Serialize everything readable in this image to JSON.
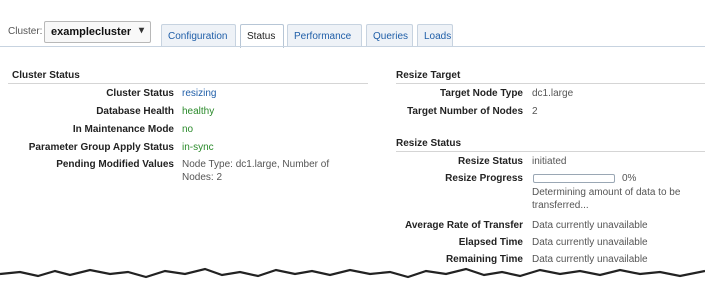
{
  "cluster": {
    "label": "Cluster:",
    "selected": "examplecluster"
  },
  "tabs": [
    {
      "label": "Configuration",
      "active": false
    },
    {
      "label": "Status",
      "active": true
    },
    {
      "label": "Performance",
      "active": false
    },
    {
      "label": "Queries",
      "active": false
    },
    {
      "label": "Loads",
      "active": false
    }
  ],
  "cluster_status": {
    "title": "Cluster Status",
    "rows": [
      {
        "label": "Cluster Status",
        "value": "resizing"
      },
      {
        "label": "Database Health",
        "value": "healthy"
      },
      {
        "label": "In Maintenance Mode",
        "value": "no"
      },
      {
        "label": "Parameter Group Apply Status",
        "value": "in-sync"
      },
      {
        "label": "Pending Modified Values",
        "value_line1": "Node Type: dc1.large, Number of",
        "value_line2": "Nodes: 2"
      }
    ]
  },
  "resize_target": {
    "title": "Resize Target",
    "rows": [
      {
        "label": "Target Node Type",
        "value": "dc1.large"
      },
      {
        "label": "Target Number of Nodes",
        "value": "2"
      }
    ]
  },
  "resize_status": {
    "title": "Resize Status",
    "status_label": "Resize Status",
    "status_value": "initiated",
    "progress_label": "Resize Progress",
    "progress_percent": 0,
    "progress_text": "0%",
    "progress_note_line1": "Determining amount of data to be",
    "progress_note_line2": "transferred...",
    "rows": [
      {
        "label": "Average Rate of Transfer",
        "value": "Data currently unavailable"
      },
      {
        "label": "Elapsed Time",
        "value": "Data currently unavailable"
      },
      {
        "label": "Remaining Time",
        "value": "Data currently unavailable"
      }
    ]
  },
  "colors": {
    "link": "#1f5ea8",
    "ok": "#2a8a2a",
    "tab_border": "#c7d3e0"
  }
}
